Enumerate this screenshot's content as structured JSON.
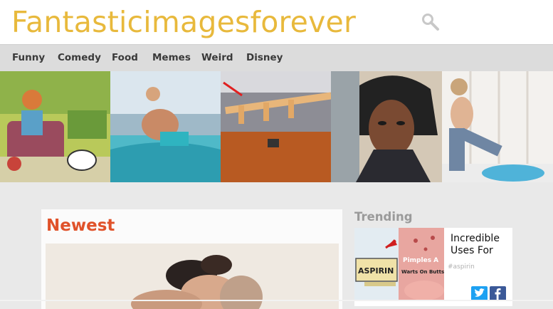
{
  "site": {
    "title": "Fantasticimagesforever"
  },
  "header": {
    "search_icon": "search-icon"
  },
  "nav": {
    "items": [
      {
        "label": "Funny"
      },
      {
        "label": "Comedy"
      },
      {
        "label": "Food"
      },
      {
        "label": "Memes"
      },
      {
        "label": "Weird"
      },
      {
        "label": "Disney"
      }
    ]
  },
  "strip": {
    "thumbs": [
      {
        "alt": "cartoon-illustration"
      },
      {
        "alt": "couple-on-boat"
      },
      {
        "alt": "wooden-shelf-floor"
      },
      {
        "alt": "woman-portrait"
      },
      {
        "alt": "woman-kiddie-pool"
      }
    ]
  },
  "newest": {
    "heading": "Newest"
  },
  "trending": {
    "heading": "Trending",
    "card": {
      "title": "Incredible Uses For",
      "tag": "#aspirin",
      "image_labels": {
        "aspirin": "ASPIRIN",
        "pimples": "Pimples A",
        "warts": "Warts On Butts"
      }
    }
  },
  "colors": {
    "logo": "#e8b93c",
    "nav_bg": "#dcdcdc",
    "newest": "#e0522a",
    "trending": "#9a9a9a",
    "twitter": "#1da1f2",
    "facebook": "#3b5998"
  }
}
